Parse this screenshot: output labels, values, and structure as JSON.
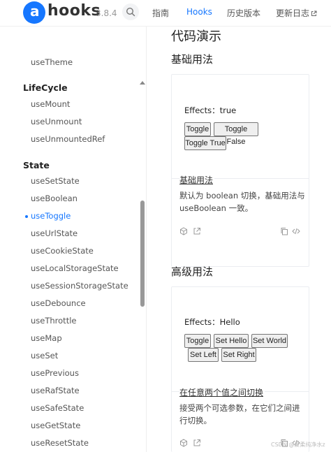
{
  "header": {
    "logo_letter": "a",
    "logo_text": "hooks",
    "version": "3.8.4",
    "nav": [
      {
        "label": "指南"
      },
      {
        "label": "Hooks"
      },
      {
        "label": "历史版本"
      },
      {
        "label": "更新日志"
      }
    ],
    "brand_color": "#1677ff"
  },
  "sidebar": {
    "items_top": [
      {
        "label": "useTheme"
      }
    ],
    "groups": [
      {
        "title": "LifeCycle",
        "items": [
          {
            "label": "useMount"
          },
          {
            "label": "useUnmount"
          },
          {
            "label": "useUnmountedRef"
          }
        ]
      },
      {
        "title": "State",
        "items": [
          {
            "label": "useSetState"
          },
          {
            "label": "useBoolean"
          },
          {
            "label": "useToggle"
          },
          {
            "label": "useUrlState"
          },
          {
            "label": "useCookieState"
          },
          {
            "label": "useLocalStorageState"
          },
          {
            "label": "useSessionStorageState"
          },
          {
            "label": "useDebounce"
          },
          {
            "label": "useThrottle"
          },
          {
            "label": "useMap"
          },
          {
            "label": "useSet"
          },
          {
            "label": "usePrevious"
          },
          {
            "label": "useRafState"
          },
          {
            "label": "useSafeState"
          },
          {
            "label": "useGetState"
          },
          {
            "label": "useResetState"
          }
        ]
      }
    ],
    "active_item": "useToggle"
  },
  "main": {
    "heading": "代码演示",
    "sections": [
      {
        "title": "基础用法",
        "effects_label": "Effects：",
        "effects_value": "true",
        "buttons": [
          "Toggle",
          "Toggle False",
          "Toggle True"
        ],
        "demo_title": "基础用法",
        "demo_desc": "默认为 boolean 切换，基础用法与 useBoolean 一致。"
      },
      {
        "title": "高级用法",
        "effects_label": "Effects：",
        "effects_value": "Hello",
        "buttons": [
          "Toggle",
          "Set Hello",
          "Set World",
          "Set Left",
          "Set Right"
        ],
        "demo_title": "在任意两个值之间切换",
        "demo_desc": "接受两个可选参数，在它们之间进行切换。"
      }
    ]
  },
  "watermark": "CSDN @爱柔纯净水z"
}
